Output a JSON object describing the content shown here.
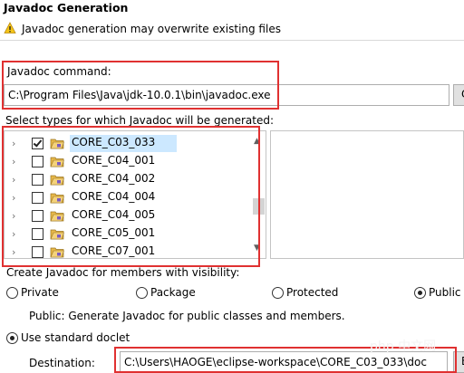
{
  "dialog": {
    "title": "Javadoc Generation",
    "warning": "Javadoc generation may overwrite existing files"
  },
  "command": {
    "label": "Javadoc command:",
    "value": "C:\\Program Files\\Java\\jdk-10.0.1\\bin\\javadoc.exe",
    "configure_label": "C"
  },
  "types": {
    "label": "Select types for which Javadoc will be generated:",
    "items": [
      {
        "name": "CORE_C03_033",
        "checked": true
      },
      {
        "name": "CORE_C04_001",
        "checked": false
      },
      {
        "name": "CORE_C04_002",
        "checked": false
      },
      {
        "name": "CORE_C04_004",
        "checked": false
      },
      {
        "name": "CORE_C04_005",
        "checked": false
      },
      {
        "name": "CORE_C05_001",
        "checked": false
      },
      {
        "name": "CORE_C07_001",
        "checked": false
      }
    ]
  },
  "visibility": {
    "label": "Create Javadoc for members with visibility:",
    "options": [
      "Private",
      "Package",
      "Protected",
      "Public"
    ],
    "selected": "Public",
    "description": "Public: Generate Javadoc for public classes and members."
  },
  "doclet": {
    "standard_label": "Use standard doclet",
    "destination_label": "Destination:",
    "destination_value": "C:\\Users\\HAOGE\\eclipse-workspace\\CORE_C03_033\\doc",
    "browse_label": "B"
  },
  "watermark": "php 中文网",
  "colors": {
    "highlight": "#e03131",
    "selection": "#cce8ff",
    "folder": "#e8b94a"
  }
}
